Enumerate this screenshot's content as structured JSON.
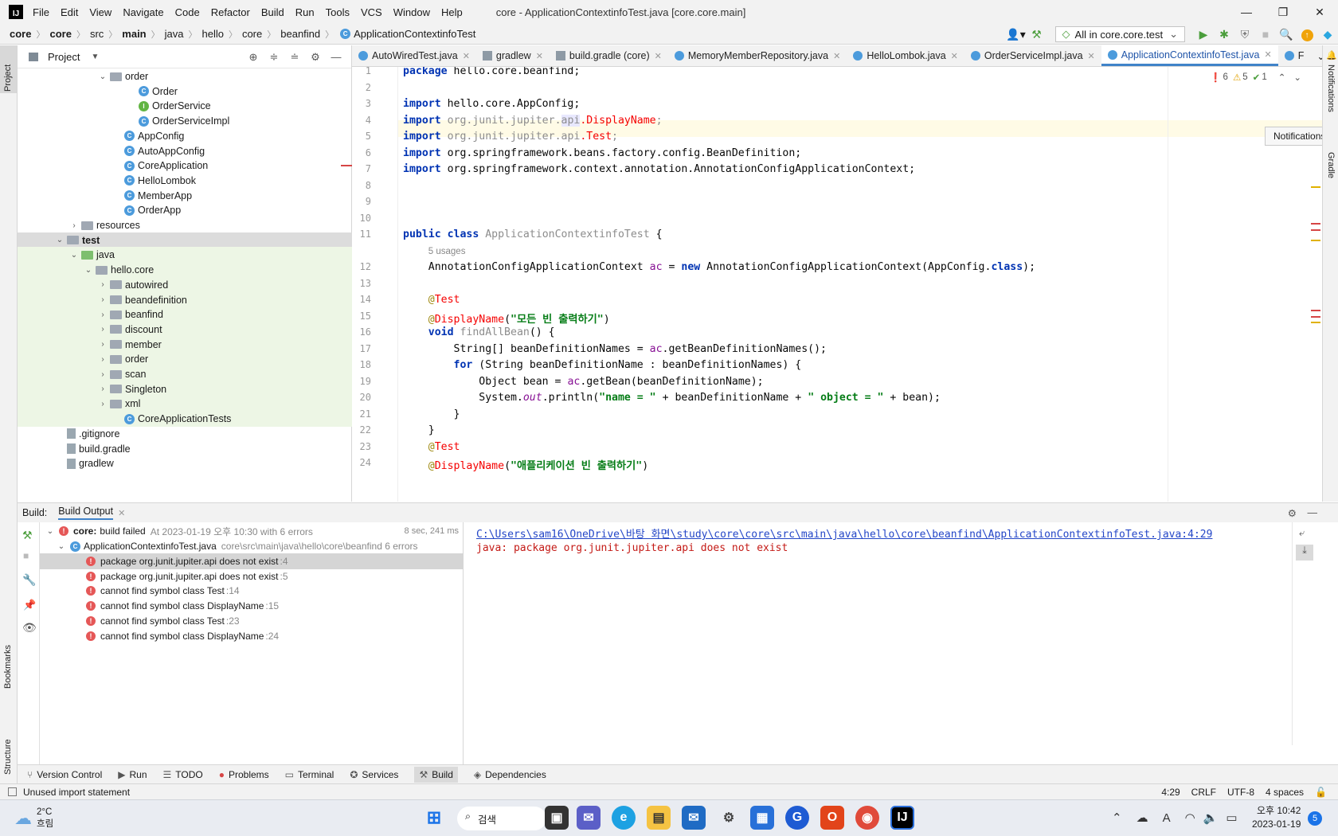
{
  "titlebar": {
    "menu": [
      "File",
      "Edit",
      "View",
      "Navigate",
      "Code",
      "Refactor",
      "Build",
      "Run",
      "Tools",
      "VCS",
      "Window",
      "Help"
    ],
    "window_title": "core - ApplicationContextinfoTest.java [core.core.main]"
  },
  "navbar": {
    "breadcrumbs": [
      "core",
      "core",
      "src",
      "main",
      "java",
      "hello",
      "core",
      "beanfind",
      "ApplicationContextinfoTest"
    ],
    "run_config": "All in core.core.test"
  },
  "project": {
    "title": "Project",
    "tree": [
      {
        "label": "order",
        "kind": "folder",
        "depth": 6
      },
      {
        "label": "Order",
        "kind": "class",
        "depth": 8
      },
      {
        "label": "OrderService",
        "kind": "interface",
        "depth": 8
      },
      {
        "label": "OrderServiceImpl",
        "kind": "class",
        "depth": 8
      },
      {
        "label": "AppConfig",
        "kind": "class",
        "depth": 7
      },
      {
        "label": "AutoAppConfig",
        "kind": "class",
        "depth": 7
      },
      {
        "label": "CoreApplication",
        "kind": "class",
        "depth": 7
      },
      {
        "label": "HelloLombok",
        "kind": "class",
        "depth": 7
      },
      {
        "label": "MemberApp",
        "kind": "class",
        "depth": 7
      },
      {
        "label": "OrderApp",
        "kind": "class",
        "depth": 7
      },
      {
        "label": "resources",
        "kind": "folder",
        "depth": 4
      },
      {
        "label": "test",
        "kind": "folder",
        "depth": 3
      },
      {
        "label": "java",
        "kind": "folder",
        "depth": 4
      },
      {
        "label": "hello.core",
        "kind": "folder",
        "depth": 5
      },
      {
        "label": "autowired",
        "kind": "folder",
        "depth": 6
      },
      {
        "label": "beandefinition",
        "kind": "folder",
        "depth": 6
      },
      {
        "label": "beanfind",
        "kind": "folder",
        "depth": 6
      },
      {
        "label": "discount",
        "kind": "folder",
        "depth": 6
      },
      {
        "label": "member",
        "kind": "folder",
        "depth": 6
      },
      {
        "label": "order",
        "kind": "folder",
        "depth": 6
      },
      {
        "label": "scan",
        "kind": "folder",
        "depth": 6
      },
      {
        "label": "Singleton",
        "kind": "folder",
        "depth": 6
      },
      {
        "label": "xml",
        "kind": "folder",
        "depth": 6
      },
      {
        "label": "CoreApplicationTests",
        "kind": "class",
        "depth": 7
      },
      {
        "label": ".gitignore",
        "kind": "file",
        "depth": 3
      },
      {
        "label": "build.gradle",
        "kind": "file",
        "depth": 3
      },
      {
        "label": "gradlew",
        "kind": "file",
        "depth": 3
      }
    ]
  },
  "tabs": [
    {
      "label": "AutoWiredTest.java",
      "active": false
    },
    {
      "label": "gradlew",
      "active": false
    },
    {
      "label": "build.gradle (core)",
      "active": false
    },
    {
      "label": "MemoryMemberRepository.java",
      "active": false
    },
    {
      "label": "HelloLombok.java",
      "active": false
    },
    {
      "label": "OrderServiceImpl.java",
      "active": false
    },
    {
      "label": "ApplicationContextinfoTest.java",
      "active": true
    },
    {
      "label": "F",
      "active": false
    }
  ],
  "editor": {
    "inspections": {
      "errors": "6",
      "warnings": "5",
      "ok": "1"
    },
    "usages_hint": "5 usages",
    "line_numbers": [
      "1",
      "2",
      "3",
      "4",
      "5",
      "6",
      "7",
      "8",
      "9",
      "10",
      "11",
      "12",
      "13",
      "14",
      "15",
      "16",
      "17",
      "18",
      "19",
      "20",
      "21",
      "22",
      "23",
      "24"
    ]
  },
  "notifications_tooltip": "Notifications",
  "right_stripe": {
    "notifications": "Notifications",
    "gradle": "Gradle"
  },
  "left_stripe": {
    "project": "Project",
    "bookmarks": "Bookmarks",
    "structure": "Structure"
  },
  "build": {
    "label": "Build:",
    "tab": "Build Output",
    "summary_bold": "core:",
    "summary": "build failed",
    "summary_time": "At 2023-01-19 오후 10:30 with 6 errors",
    "duration": "8 sec, 241 ms",
    "file_label": "ApplicationContextinfoTest.java",
    "file_path": "core\\src\\main\\java\\hello\\core\\beanfind 6 errors",
    "errors": [
      {
        "msg": "package org.junit.jupiter.api does not exist",
        "line": ":4"
      },
      {
        "msg": "package org.junit.jupiter.api does not exist",
        "line": ":5"
      },
      {
        "msg": "cannot find symbol class Test",
        "line": ":14"
      },
      {
        "msg": "cannot find symbol class DisplayName",
        "line": ":15"
      },
      {
        "msg": "cannot find symbol class Test",
        "line": ":23"
      },
      {
        "msg": "cannot find symbol class DisplayName",
        "line": ":24"
      }
    ],
    "output_link": "C:\\Users\\sam16\\OneDrive\\바탕 화면\\study\\core\\core\\src\\main\\java\\hello\\core\\beanfind\\ApplicationContextinfoTest.java:4:29",
    "output_msg": "java: package org.junit.jupiter.api does not exist"
  },
  "toolwindows": [
    "Version Control",
    "Run",
    "TODO",
    "Problems",
    "Terminal",
    "Services",
    "Build",
    "Dependencies"
  ],
  "status": {
    "message": "Unused import statement",
    "position": "4:29",
    "line_sep": "CRLF",
    "encoding": "UTF-8",
    "indent": "4 spaces"
  },
  "taskbar": {
    "weather_temp": "2°C",
    "weather_desc": "흐림",
    "search": "검색",
    "time": "오후 10:42",
    "date": "2023-01-19",
    "notif_count": "5"
  }
}
